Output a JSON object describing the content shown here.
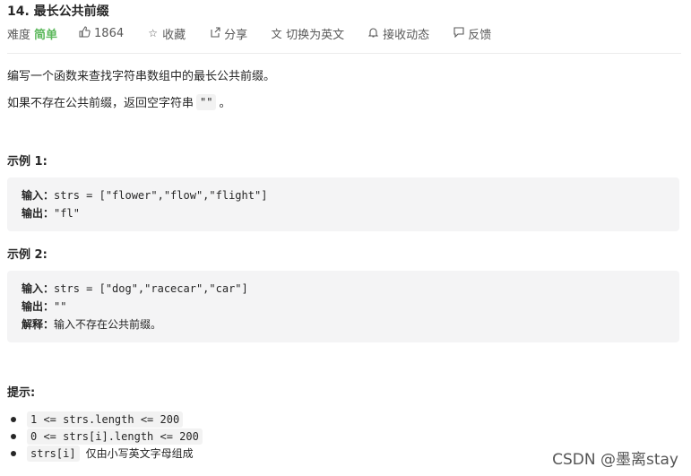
{
  "problem": {
    "title": "14. 最长公共前缀"
  },
  "meta": {
    "difficulty_label": "难度",
    "difficulty_value": "简单",
    "likes": "1864",
    "favorite": "收藏",
    "share": "分享",
    "switch_lang": "切换为英文",
    "notify": "接收动态",
    "feedback": "反馈",
    "icons": [
      "thumbs-up-icon",
      "star-icon",
      "share-icon",
      "translate-icon",
      "bell-icon",
      "feedback-icon"
    ]
  },
  "description": {
    "line1": "编写一个函数来查找字符串数组中的最长公共前缀。",
    "line2_prefix": "如果不存在公共前缀，返回空字符串",
    "line2_code": "\"\"",
    "line2_suffix": "。"
  },
  "examples": [
    {
      "label": "示例 1:",
      "input_label": "输入：",
      "input": "strs = [\"flower\",\"flow\",\"flight\"]",
      "output_label": "输出：",
      "output": "\"fl\""
    },
    {
      "label": "示例 2:",
      "input_label": "输入：",
      "input": "strs = [\"dog\",\"racecar\",\"car\"]",
      "output_label": "输出：",
      "output": "\"\"",
      "explain_label": "解释：",
      "explain": "输入不存在公共前缀。"
    }
  ],
  "hints": {
    "label": "提示:",
    "items": [
      {
        "code": "1 <= strs.length <= 200",
        "text": ""
      },
      {
        "code": "0 <= strs[i].length <= 200",
        "text": ""
      },
      {
        "code": "strs[i]",
        "text": "仅由小写英文字母组成"
      }
    ]
  },
  "watermark": "CSDN @墨离stay",
  "colors": {
    "difficulty_easy": "#5cb85c",
    "code_bg": "#f4f4f5"
  }
}
